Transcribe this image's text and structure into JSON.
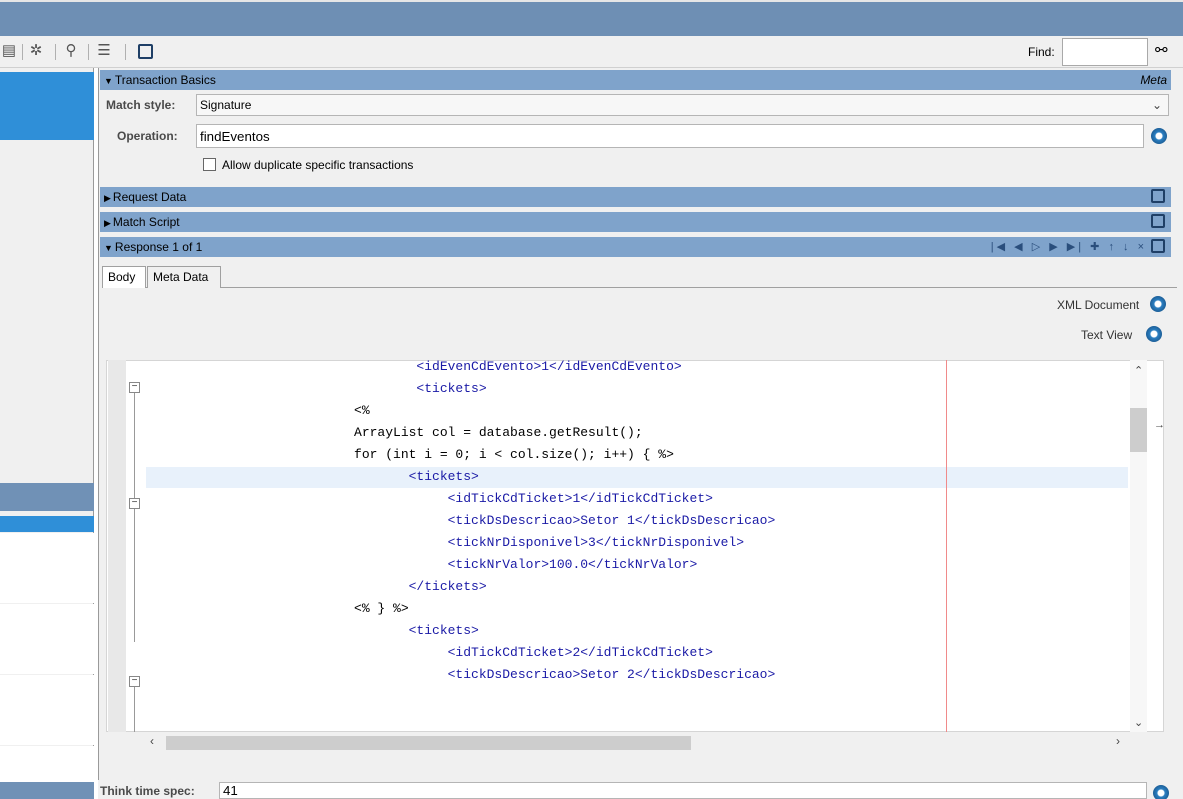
{
  "toolbar": {
    "icons": [
      "database-icon",
      "gear-cog-icon",
      "search-icon",
      "format-icon",
      "external-link-icon"
    ],
    "find_label": "Find:",
    "find_value": "",
    "find_icon": "binoculars-icon"
  },
  "transaction_basics": {
    "header": "Transaction Basics",
    "meta_label": "Meta",
    "match_style_label": "Match style:",
    "match_style_value": "Signature",
    "operation_label": "Operation:",
    "operation_value": "findEventos",
    "allow_duplicate_label": "Allow duplicate specific transactions",
    "allow_duplicate_checked": false
  },
  "sections": {
    "request_data": "Request Data",
    "match_script": "Match Script",
    "response": "Response 1 of 1"
  },
  "tabs": [
    {
      "label": "Body",
      "active": true
    },
    {
      "label": "Meta Data",
      "active": false
    }
  ],
  "view_links": {
    "xml_document": "XML Document",
    "text_view": "Text View"
  },
  "code_lines": [
    {
      "indent": "                  ",
      "text": "<idEvenCdEvento>1</idEvenCdEvento>",
      "kind": "tag"
    },
    {
      "indent": "                  ",
      "text": "<tickets>",
      "kind": "tag"
    },
    {
      "indent": "",
      "text": "",
      "kind": "plain"
    },
    {
      "indent": "          ",
      "text": "<%",
      "kind": "plain"
    },
    {
      "indent": "          ",
      "text": "ArrayList col = database.getResult();",
      "kind": "plain"
    },
    {
      "indent": "          ",
      "text": "for (int i = 0; i < col.size(); i++) { %>",
      "kind": "plain"
    },
    {
      "indent": "                 ",
      "text": "<tickets>",
      "kind": "tag"
    },
    {
      "indent": "                      ",
      "text": "<idTickCdTicket>1</idTickCdTicket>",
      "kind": "tag"
    },
    {
      "indent": "                      ",
      "text": "<tickDsDescricao>Setor 1</tickDsDescricao>",
      "kind": "tag"
    },
    {
      "indent": "                      ",
      "text": "<tickNrDisponivel>3</tickNrDisponivel>",
      "kind": "tag"
    },
    {
      "indent": "                      ",
      "text": "<tickNrValor>100.0</tickNrValor>",
      "kind": "tag"
    },
    {
      "indent": "                 ",
      "text": "</tickets>",
      "kind": "tag"
    },
    {
      "indent": "          ",
      "text": "<% } %>",
      "kind": "plain"
    },
    {
      "indent": "",
      "text": "",
      "kind": "plain"
    },
    {
      "indent": "                 ",
      "text": "<tickets>",
      "kind": "tag"
    },
    {
      "indent": "                      ",
      "text": "<idTickCdTicket>2</idTickCdTicket>",
      "kind": "tag"
    },
    {
      "indent": "                      ",
      "text": "<tickDsDescricao>Setor 2</tickDsDescricao>",
      "kind": "tag"
    }
  ],
  "think_time": {
    "label": "Think time spec:",
    "value": "41"
  },
  "colors": {
    "title_bar": "#6e8fb4",
    "section_header": "#7fa3cb",
    "selection": "#2f8fd8",
    "xml_tag": "#1a1aa6",
    "margin_line": "#f08a8a"
  }
}
